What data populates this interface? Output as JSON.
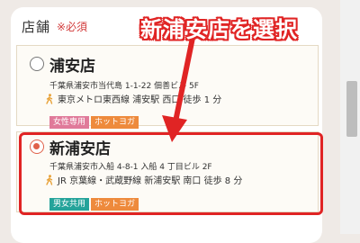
{
  "form": {
    "field_label": "店舗",
    "required_mark": "※必須"
  },
  "annotation": {
    "callout_text": "新浦安店を選択",
    "color": "#e02424"
  },
  "stores": [
    {
      "name": "浦安店",
      "selected": false,
      "address": "千葉県浦安市当代島 1-1-22 佃善ビル 5F",
      "access": "東京メトロ東西線 浦安駅 西口 徒歩 1 分",
      "badges": [
        {
          "label": "女性専用",
          "color": "#e07a9a"
        },
        {
          "label": "ホットヨガ",
          "color": "#ee8a3c"
        }
      ]
    },
    {
      "name": "新浦安店",
      "selected": true,
      "address": "千葉県浦安市入船 4-8-1 入船 4 丁目ビル 2F",
      "access": "JR 京葉線・武蔵野線 新浦安駅 南口 徒歩 8 分",
      "badges": [
        {
          "label": "男女共用",
          "color": "#24a39a"
        },
        {
          "label": "ホットヨガ",
          "color": "#ee8a3c"
        }
      ]
    }
  ],
  "icons": {
    "walk": "walking-person-icon",
    "radio_selected": "radio-selected-icon",
    "radio_empty": "radio-empty-icon"
  }
}
